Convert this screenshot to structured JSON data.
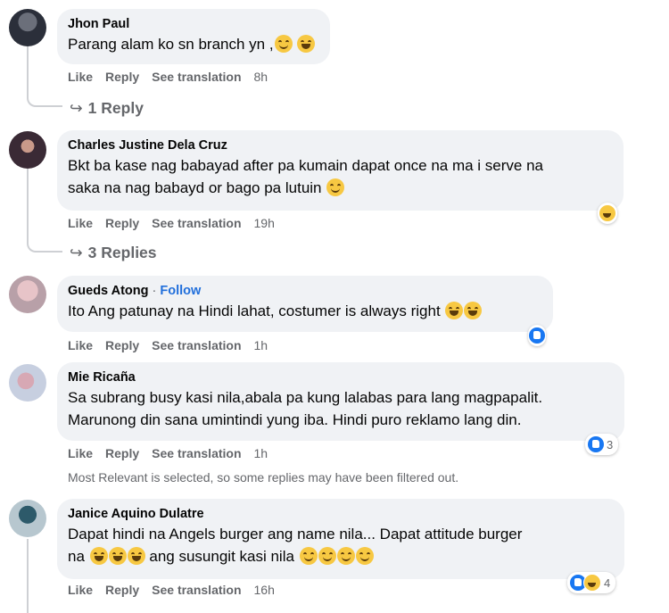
{
  "actions": {
    "like": "Like",
    "reply": "Reply",
    "see_translation": "See translation"
  },
  "comments": [
    {
      "author": "Jhon Paul",
      "lines": [
        "Parang alam ko sn branch yn ,"
      ],
      "time": "8h",
      "replies_label": "1 Reply"
    },
    {
      "author": "Charles Justine Dela Cruz",
      "lines": [
        "Bkt ba kase nag babayad after pa kumain dapat once na ma i serve na",
        "saka na nag babayd or bago pa lutuin"
      ],
      "time": "19h",
      "replies_label": "3 Replies"
    },
    {
      "author": "Gueds Atong",
      "follow": "Follow",
      "separator": "·",
      "lines": [
        "Ito Ang patunay na Hindi lahat, costumer is always right"
      ],
      "time": "1h"
    },
    {
      "author": "Mie Ricaña",
      "lines": [
        "Sa subrang busy kasi nila,abala pa kung lalabas para lang magpapalit.",
        "Marunong din sana umintindi yung iba. Hindi puro reklamo lang din."
      ],
      "time": "1h",
      "reaction_count": "3"
    },
    {
      "author": "Janice Aquino Dulatre",
      "lines": [
        "Dapat hindi na Angels burger ang name nila... Dapat attitude burger",
        "na",
        "ang susungit kasi nila"
      ],
      "time": "16h",
      "reaction_count": "4"
    }
  ],
  "filter_notice": "Most Relevant is selected, so some replies may have been filtered out.",
  "reply_arrow": "↪"
}
